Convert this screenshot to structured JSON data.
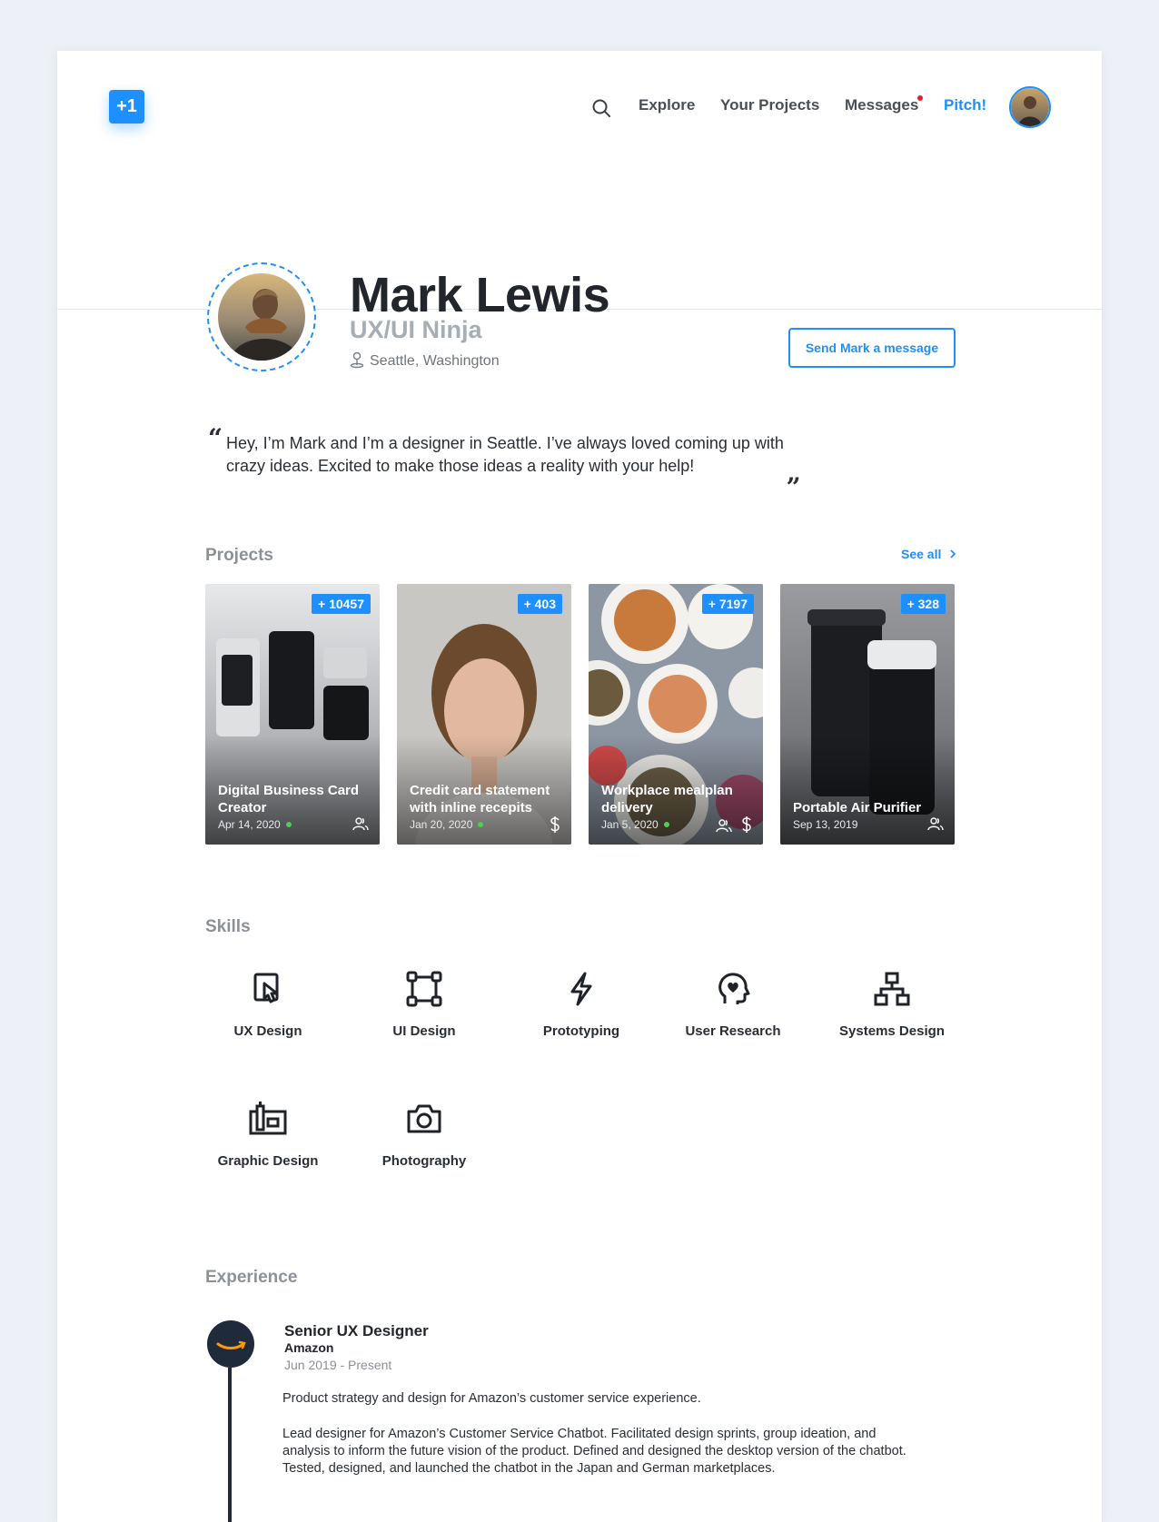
{
  "nav": {
    "logo": "+1",
    "explore": "Explore",
    "your_projects": "Your Projects",
    "messages": "Messages",
    "pitch": "Pitch!"
  },
  "profile": {
    "name": "Mark Lewis",
    "role": "UX/UI Ninja",
    "location": "Seattle, Washington",
    "message_button": "Send Mark a message",
    "quote": "Hey, I’m Mark and I’m a designer in Seattle. I’ve always loved coming up with crazy ideas. Excited to make those ideas a reality with your help!",
    "quote_open": "“",
    "quote_close": "„"
  },
  "projects": {
    "title": "Projects",
    "see_all": "See all",
    "items": [
      {
        "badge": "+ 10457",
        "title": "Digital Business Card Creator",
        "date": "Apr 14, 2020",
        "icons": [
          "people-icon"
        ]
      },
      {
        "badge": "+ 403",
        "title": "Credit card statement with inline recepits",
        "date": "Jan 20, 2020",
        "icons": [
          "dollar-icon"
        ]
      },
      {
        "badge": "+ 7197",
        "title": "Workplace mealplan delivery",
        "date": "Jan 5, 2020",
        "icons": [
          "people-icon",
          "dollar-icon"
        ]
      },
      {
        "badge": "+ 328",
        "title": "Portable Air Purifier",
        "date": "Sep 13, 2019",
        "icons": [
          "people-icon"
        ]
      }
    ]
  },
  "skills": {
    "title": "Skills",
    "items": [
      {
        "label": "UX Design",
        "icon": "touch-screen-icon"
      },
      {
        "label": "UI Design",
        "icon": "vector-frame-icon"
      },
      {
        "label": "Prototyping",
        "icon": "lightning-icon"
      },
      {
        "label": "User Research",
        "icon": "head-heart-icon"
      },
      {
        "label": "Systems Design",
        "icon": "hierarchy-icon"
      },
      {
        "label": "Graphic Design",
        "icon": "pencil-ruler-icon"
      },
      {
        "label": "Photography",
        "icon": "camera-icon"
      }
    ]
  },
  "experience": {
    "title": "Experience",
    "items": [
      {
        "position": "Senior UX Designer",
        "company": "Amazon",
        "dates": "Jun 2019 - Present",
        "summary": "Product strategy and design for Amazon’s customer service experience.",
        "details": "Lead designer for Amazon’s Customer Service Chatbot. Facilitated design sprints, group ideation, and analysis to inform the future vision of the product. Defined and designed the desktop version of the chatbot. Tested, designed, and launched the chatbot in the Japan and German marketplaces."
      }
    ]
  },
  "colors": {
    "accent": "#1e8fff",
    "online": "#49d24a",
    "notification": "#e8202a",
    "page_bg": "#edf1f7"
  }
}
